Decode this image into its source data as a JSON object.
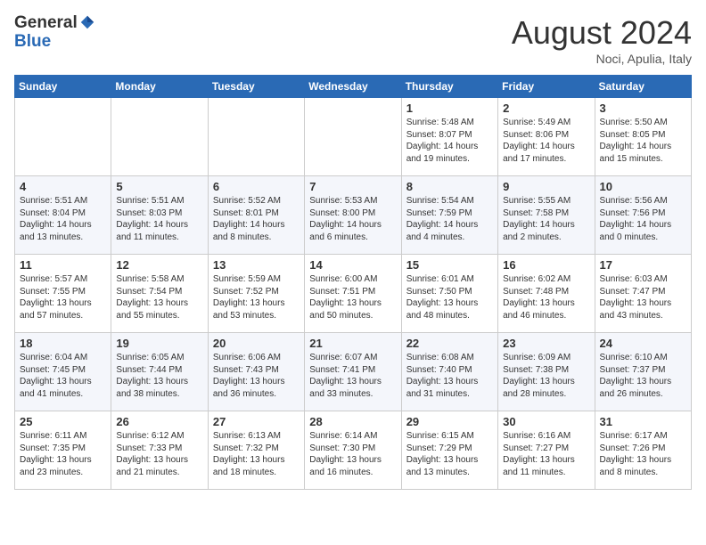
{
  "header": {
    "logo_general": "General",
    "logo_blue": "Blue",
    "month_year": "August 2024",
    "location": "Noci, Apulia, Italy"
  },
  "weekdays": [
    "Sunday",
    "Monday",
    "Tuesday",
    "Wednesday",
    "Thursday",
    "Friday",
    "Saturday"
  ],
  "weeks": [
    [
      {
        "day": "",
        "info": ""
      },
      {
        "day": "",
        "info": ""
      },
      {
        "day": "",
        "info": ""
      },
      {
        "day": "",
        "info": ""
      },
      {
        "day": "1",
        "info": "Sunrise: 5:48 AM\nSunset: 8:07 PM\nDaylight: 14 hours and 19 minutes."
      },
      {
        "day": "2",
        "info": "Sunrise: 5:49 AM\nSunset: 8:06 PM\nDaylight: 14 hours and 17 minutes."
      },
      {
        "day": "3",
        "info": "Sunrise: 5:50 AM\nSunset: 8:05 PM\nDaylight: 14 hours and 15 minutes."
      }
    ],
    [
      {
        "day": "4",
        "info": "Sunrise: 5:51 AM\nSunset: 8:04 PM\nDaylight: 14 hours and 13 minutes."
      },
      {
        "day": "5",
        "info": "Sunrise: 5:51 AM\nSunset: 8:03 PM\nDaylight: 14 hours and 11 minutes."
      },
      {
        "day": "6",
        "info": "Sunrise: 5:52 AM\nSunset: 8:01 PM\nDaylight: 14 hours and 8 minutes."
      },
      {
        "day": "7",
        "info": "Sunrise: 5:53 AM\nSunset: 8:00 PM\nDaylight: 14 hours and 6 minutes."
      },
      {
        "day": "8",
        "info": "Sunrise: 5:54 AM\nSunset: 7:59 PM\nDaylight: 14 hours and 4 minutes."
      },
      {
        "day": "9",
        "info": "Sunrise: 5:55 AM\nSunset: 7:58 PM\nDaylight: 14 hours and 2 minutes."
      },
      {
        "day": "10",
        "info": "Sunrise: 5:56 AM\nSunset: 7:56 PM\nDaylight: 14 hours and 0 minutes."
      }
    ],
    [
      {
        "day": "11",
        "info": "Sunrise: 5:57 AM\nSunset: 7:55 PM\nDaylight: 13 hours and 57 minutes."
      },
      {
        "day": "12",
        "info": "Sunrise: 5:58 AM\nSunset: 7:54 PM\nDaylight: 13 hours and 55 minutes."
      },
      {
        "day": "13",
        "info": "Sunrise: 5:59 AM\nSunset: 7:52 PM\nDaylight: 13 hours and 53 minutes."
      },
      {
        "day": "14",
        "info": "Sunrise: 6:00 AM\nSunset: 7:51 PM\nDaylight: 13 hours and 50 minutes."
      },
      {
        "day": "15",
        "info": "Sunrise: 6:01 AM\nSunset: 7:50 PM\nDaylight: 13 hours and 48 minutes."
      },
      {
        "day": "16",
        "info": "Sunrise: 6:02 AM\nSunset: 7:48 PM\nDaylight: 13 hours and 46 minutes."
      },
      {
        "day": "17",
        "info": "Sunrise: 6:03 AM\nSunset: 7:47 PM\nDaylight: 13 hours and 43 minutes."
      }
    ],
    [
      {
        "day": "18",
        "info": "Sunrise: 6:04 AM\nSunset: 7:45 PM\nDaylight: 13 hours and 41 minutes."
      },
      {
        "day": "19",
        "info": "Sunrise: 6:05 AM\nSunset: 7:44 PM\nDaylight: 13 hours and 38 minutes."
      },
      {
        "day": "20",
        "info": "Sunrise: 6:06 AM\nSunset: 7:43 PM\nDaylight: 13 hours and 36 minutes."
      },
      {
        "day": "21",
        "info": "Sunrise: 6:07 AM\nSunset: 7:41 PM\nDaylight: 13 hours and 33 minutes."
      },
      {
        "day": "22",
        "info": "Sunrise: 6:08 AM\nSunset: 7:40 PM\nDaylight: 13 hours and 31 minutes."
      },
      {
        "day": "23",
        "info": "Sunrise: 6:09 AM\nSunset: 7:38 PM\nDaylight: 13 hours and 28 minutes."
      },
      {
        "day": "24",
        "info": "Sunrise: 6:10 AM\nSunset: 7:37 PM\nDaylight: 13 hours and 26 minutes."
      }
    ],
    [
      {
        "day": "25",
        "info": "Sunrise: 6:11 AM\nSunset: 7:35 PM\nDaylight: 13 hours and 23 minutes."
      },
      {
        "day": "26",
        "info": "Sunrise: 6:12 AM\nSunset: 7:33 PM\nDaylight: 13 hours and 21 minutes."
      },
      {
        "day": "27",
        "info": "Sunrise: 6:13 AM\nSunset: 7:32 PM\nDaylight: 13 hours and 18 minutes."
      },
      {
        "day": "28",
        "info": "Sunrise: 6:14 AM\nSunset: 7:30 PM\nDaylight: 13 hours and 16 minutes."
      },
      {
        "day": "29",
        "info": "Sunrise: 6:15 AM\nSunset: 7:29 PM\nDaylight: 13 hours and 13 minutes."
      },
      {
        "day": "30",
        "info": "Sunrise: 6:16 AM\nSunset: 7:27 PM\nDaylight: 13 hours and 11 minutes."
      },
      {
        "day": "31",
        "info": "Sunrise: 6:17 AM\nSunset: 7:26 PM\nDaylight: 13 hours and 8 minutes."
      }
    ]
  ]
}
